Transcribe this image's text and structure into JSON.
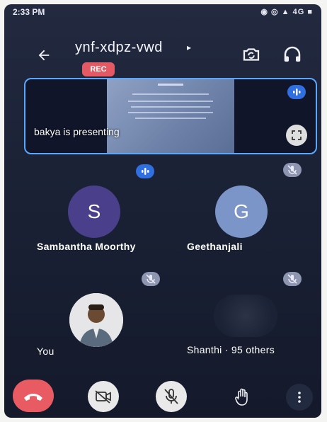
{
  "status_bar": {
    "time": "2:33 PM",
    "icons_text": "◉ ◎ ▲ 4G ■"
  },
  "meeting": {
    "code": "ynf-xdpz-vwd",
    "chevron": "▸",
    "rec_label": "REC"
  },
  "presentation": {
    "presenter_label": "bakya is presenting"
  },
  "participants": [
    {
      "name": "Sambantha Moorthy",
      "initial": "S",
      "state": "speaking"
    },
    {
      "name": "Geethanjali",
      "initial": "G",
      "state": "muted"
    },
    {
      "name": "You",
      "state": "muted"
    },
    {
      "name": "Shanthi · 95 others",
      "state": "muted"
    }
  ],
  "colors": {
    "accent": "#2f6fe0",
    "rec": "#e35a65",
    "end_call": "#e85b62",
    "tile_border": "#58a8ff"
  },
  "icons": [
    "arrow-back-icon",
    "switch-camera-icon",
    "headphones-icon",
    "audio-levels-icon",
    "fullscreen-icon",
    "mic-off-icon",
    "end-call-icon",
    "camera-off-icon",
    "raise-hand-icon",
    "more-vert-icon"
  ]
}
